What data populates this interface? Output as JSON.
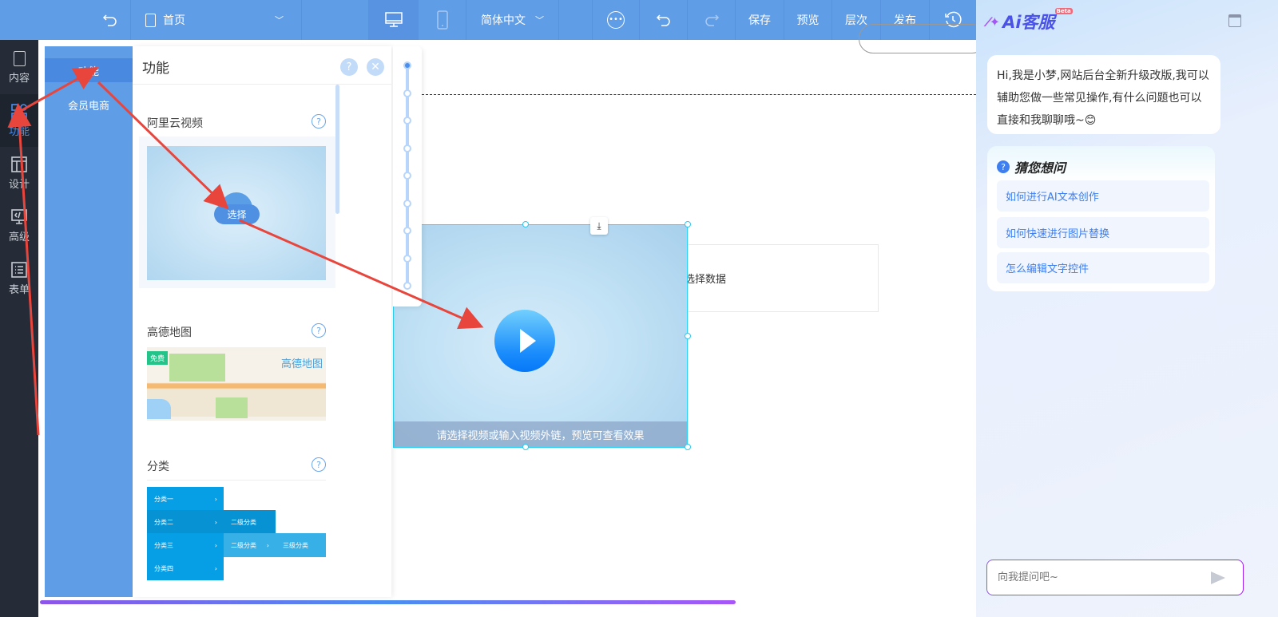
{
  "header": {
    "page_selector": "首页",
    "language": "简体中文",
    "buttons": {
      "save": "保存",
      "preview": "预览",
      "layers": "层次",
      "publish": "发布"
    }
  },
  "leftbar": {
    "items": [
      {
        "label": "内容",
        "icon": "document-icon"
      },
      {
        "label": "功能",
        "icon": "grid-icon",
        "active": true
      },
      {
        "label": "设计",
        "icon": "layout-icon"
      },
      {
        "label": "高级",
        "icon": "code-icon"
      },
      {
        "label": "表单",
        "icon": "list-icon"
      }
    ]
  },
  "categories": [
    {
      "label": "功能",
      "active": true
    },
    {
      "label": "会员电商"
    }
  ],
  "panel": {
    "title": "功能",
    "help": "?",
    "sections": [
      {
        "label": "阿里云视频",
        "button": "选择"
      },
      {
        "label": "高德地图",
        "badge": "免费",
        "map_title": "高德地图"
      },
      {
        "label": "分类"
      }
    ],
    "category_demo": {
      "level1": [
        "分类一",
        "分类二",
        "分类三",
        "分类四"
      ],
      "level2": [
        "二级分类",
        "二级分类"
      ],
      "level3": "三级分类"
    }
  },
  "canvas": {
    "video_hint": "请选择视频或输入视频外链，预览可查看效果",
    "data_placeholder": "选择数据"
  },
  "ai": {
    "logo": "Ai客服",
    "beta": "Beta",
    "greeting": "Hi,我是小梦,网站后台全新升级改版,我可以辅助您做一些常见操作,有什么问题也可以直接和我聊聊哦~😊",
    "guess_title": "猜您想问",
    "suggestions": [
      "如何进行AI文本创作",
      "如何快速进行图片替换",
      "怎么编辑文字控件"
    ],
    "input_placeholder": "向我提问吧~"
  },
  "colors": {
    "header": "#5f9de6",
    "sidebar": "#252c38",
    "accent": "#3d7ef0",
    "annotation": "#e8453c"
  }
}
